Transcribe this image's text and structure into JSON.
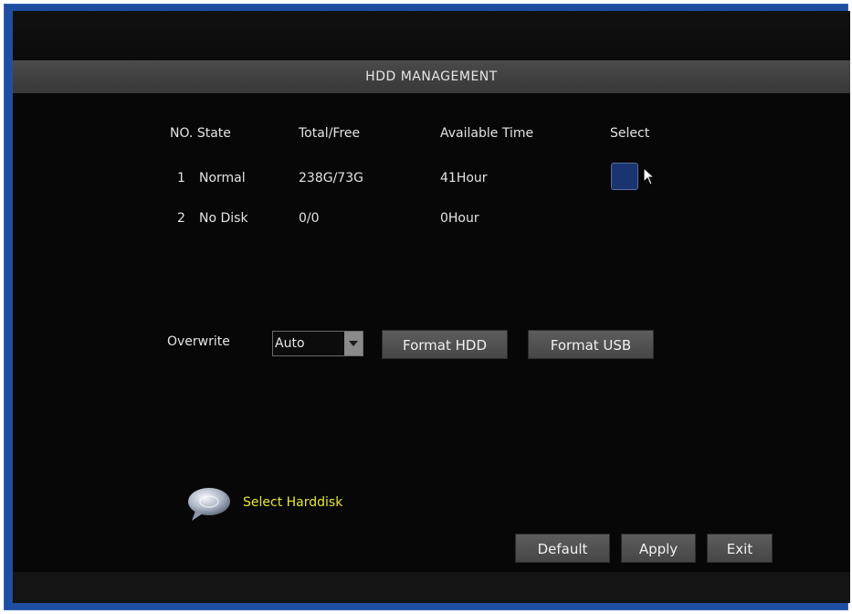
{
  "window": {
    "title": "HDD MANAGEMENT"
  },
  "table": {
    "headers": {
      "no_state": "NO. State",
      "total_free": "Total/Free",
      "available_time": "Available Time",
      "select": "Select"
    },
    "rows": [
      {
        "no": "1",
        "state": "Normal",
        "total_free": "238G/73G",
        "available_time": "41Hour",
        "selected": true
      },
      {
        "no": "2",
        "state": "No Disk",
        "total_free": "0/0",
        "available_time": "0Hour",
        "selected": false
      }
    ]
  },
  "overwrite": {
    "label": "Overwrite",
    "value": "Auto"
  },
  "buttons": {
    "format_hdd": "Format HDD",
    "format_usb": "Format USB",
    "default": "Default",
    "apply": "Apply",
    "exit": "Exit"
  },
  "hint": {
    "icon": "speech-bubble-icon",
    "text": "Select Harddisk"
  },
  "colors": {
    "frame": "#1f4ea0",
    "background": "#070707",
    "title_bar": "#404040",
    "hint_text": "#e6e63a",
    "select_box": "#1a3470"
  }
}
